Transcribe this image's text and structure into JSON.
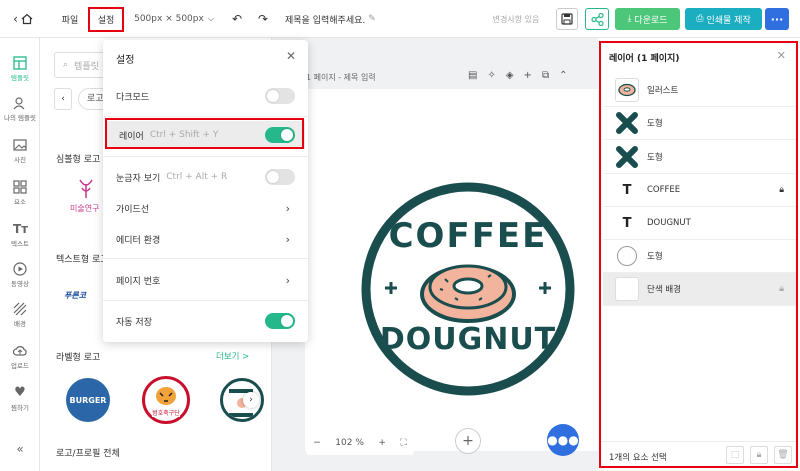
{
  "topbar": {
    "file": "파일",
    "settings": "설정",
    "size": "500px × 500px",
    "title_placeholder": "제목을 입력해주세요.",
    "saved_status": "변경사항 있음",
    "download": "다운로드",
    "print": "인쇄물 제작"
  },
  "rail": [
    {
      "label": "템플릿",
      "icon": "template-icon"
    },
    {
      "label": "나의 템플릿",
      "icon": "my-template-icon"
    },
    {
      "label": "사진",
      "icon": "photo-icon"
    },
    {
      "label": "요소",
      "icon": "element-icon"
    },
    {
      "label": "텍스트",
      "icon": "text-icon"
    },
    {
      "label": "동영상",
      "icon": "video-icon"
    },
    {
      "label": "배경",
      "icon": "background-icon"
    },
    {
      "label": "업로드",
      "icon": "upload-icon"
    },
    {
      "label": "찜하기",
      "icon": "heart-icon"
    }
  ],
  "panel": {
    "search_placeholder": "템플릿 검색",
    "tab_partial": "로고",
    "sections": [
      "심볼형 로고",
      "텍스트형 로고",
      "라벨형 로고",
      "로고/프로필 전체"
    ],
    "more": "더보기 >",
    "partial_a": "미술연구",
    "partial_b": "푸른코",
    "burger": "BURGER",
    "tiger": "범호축구단"
  },
  "settings": {
    "title": "설정",
    "darkmode": "다크모드",
    "layer": "레이어",
    "layer_shortcut": "Ctrl + Shift + Y",
    "ruler": "눈금자 보기",
    "ruler_shortcut": "Ctrl + Alt + R",
    "guides": "가이드선",
    "editor_env": "에디터 환경",
    "page_numbers": "페이지 번호",
    "autosave": "자동 저장"
  },
  "canvas": {
    "page_label": "1 페이지 - 제목 입력",
    "zoom": "102",
    "zoom_unit": "%",
    "logo_top": "COFFEE",
    "logo_bottom": "DOUGNUT"
  },
  "layers": {
    "title": "레이어 (1 페이지)",
    "items": [
      {
        "name": "일러스트",
        "locked": false
      },
      {
        "name": "도형",
        "locked": false
      },
      {
        "name": "도형",
        "locked": false
      },
      {
        "name": "COFFEE",
        "locked": true
      },
      {
        "name": "DOUGNUT",
        "locked": false
      },
      {
        "name": "도형",
        "locked": false
      },
      {
        "name": "단색 배경",
        "locked": true
      }
    ],
    "footer": "1개의 요소 선택"
  },
  "colors": {
    "accent": "#1a4d4d",
    "green": "#25b88a",
    "download": "#4cc77a",
    "print": "#1aaec0",
    "more": "#2f6fe0",
    "red": "#e60012",
    "donut": "#f2b49c"
  }
}
